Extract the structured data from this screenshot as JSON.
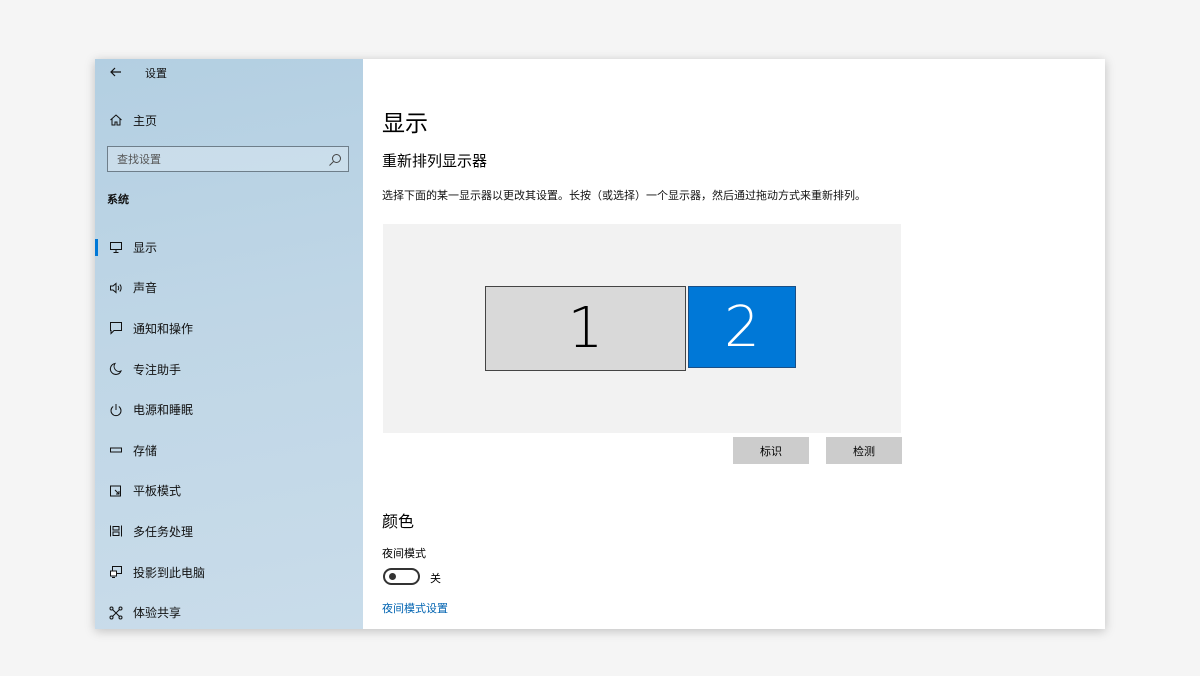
{
  "window": {
    "title": "设置",
    "accent_color": "#0078d7"
  },
  "sidebar": {
    "home_label": "主页",
    "search_placeholder": "查找设置",
    "section_label": "系统",
    "items": [
      {
        "label": "显示",
        "icon": "monitor-icon",
        "active": true
      },
      {
        "label": "声音",
        "icon": "speaker-icon",
        "active": false
      },
      {
        "label": "通知和操作",
        "icon": "notification-icon",
        "active": false
      },
      {
        "label": "专注助手",
        "icon": "moon-icon",
        "active": false
      },
      {
        "label": "电源和睡眠",
        "icon": "power-icon",
        "active": false
      },
      {
        "label": "存储",
        "icon": "storage-icon",
        "active": false
      },
      {
        "label": "平板模式",
        "icon": "tablet-icon",
        "active": false
      },
      {
        "label": "多任务处理",
        "icon": "multitask-icon",
        "active": false
      },
      {
        "label": "投影到此电脑",
        "icon": "project-icon",
        "active": false
      },
      {
        "label": "体验共享",
        "icon": "share-icon",
        "active": false
      }
    ]
  },
  "main": {
    "title": "显示",
    "rearrange_heading": "重新排列显示器",
    "rearrange_desc": "选择下面的某一显示器以更改其设置。长按（或选择）一个显示器，然后通过拖动方式来重新排列。",
    "monitors": [
      {
        "label": "1",
        "selected": false
      },
      {
        "label": "2",
        "selected": true
      }
    ],
    "identify_button": "标识",
    "detect_button": "检测",
    "color_heading": "颜色",
    "night_light_label": "夜间模式",
    "night_light_state": "关",
    "night_light_settings_link": "夜间模式设置"
  }
}
